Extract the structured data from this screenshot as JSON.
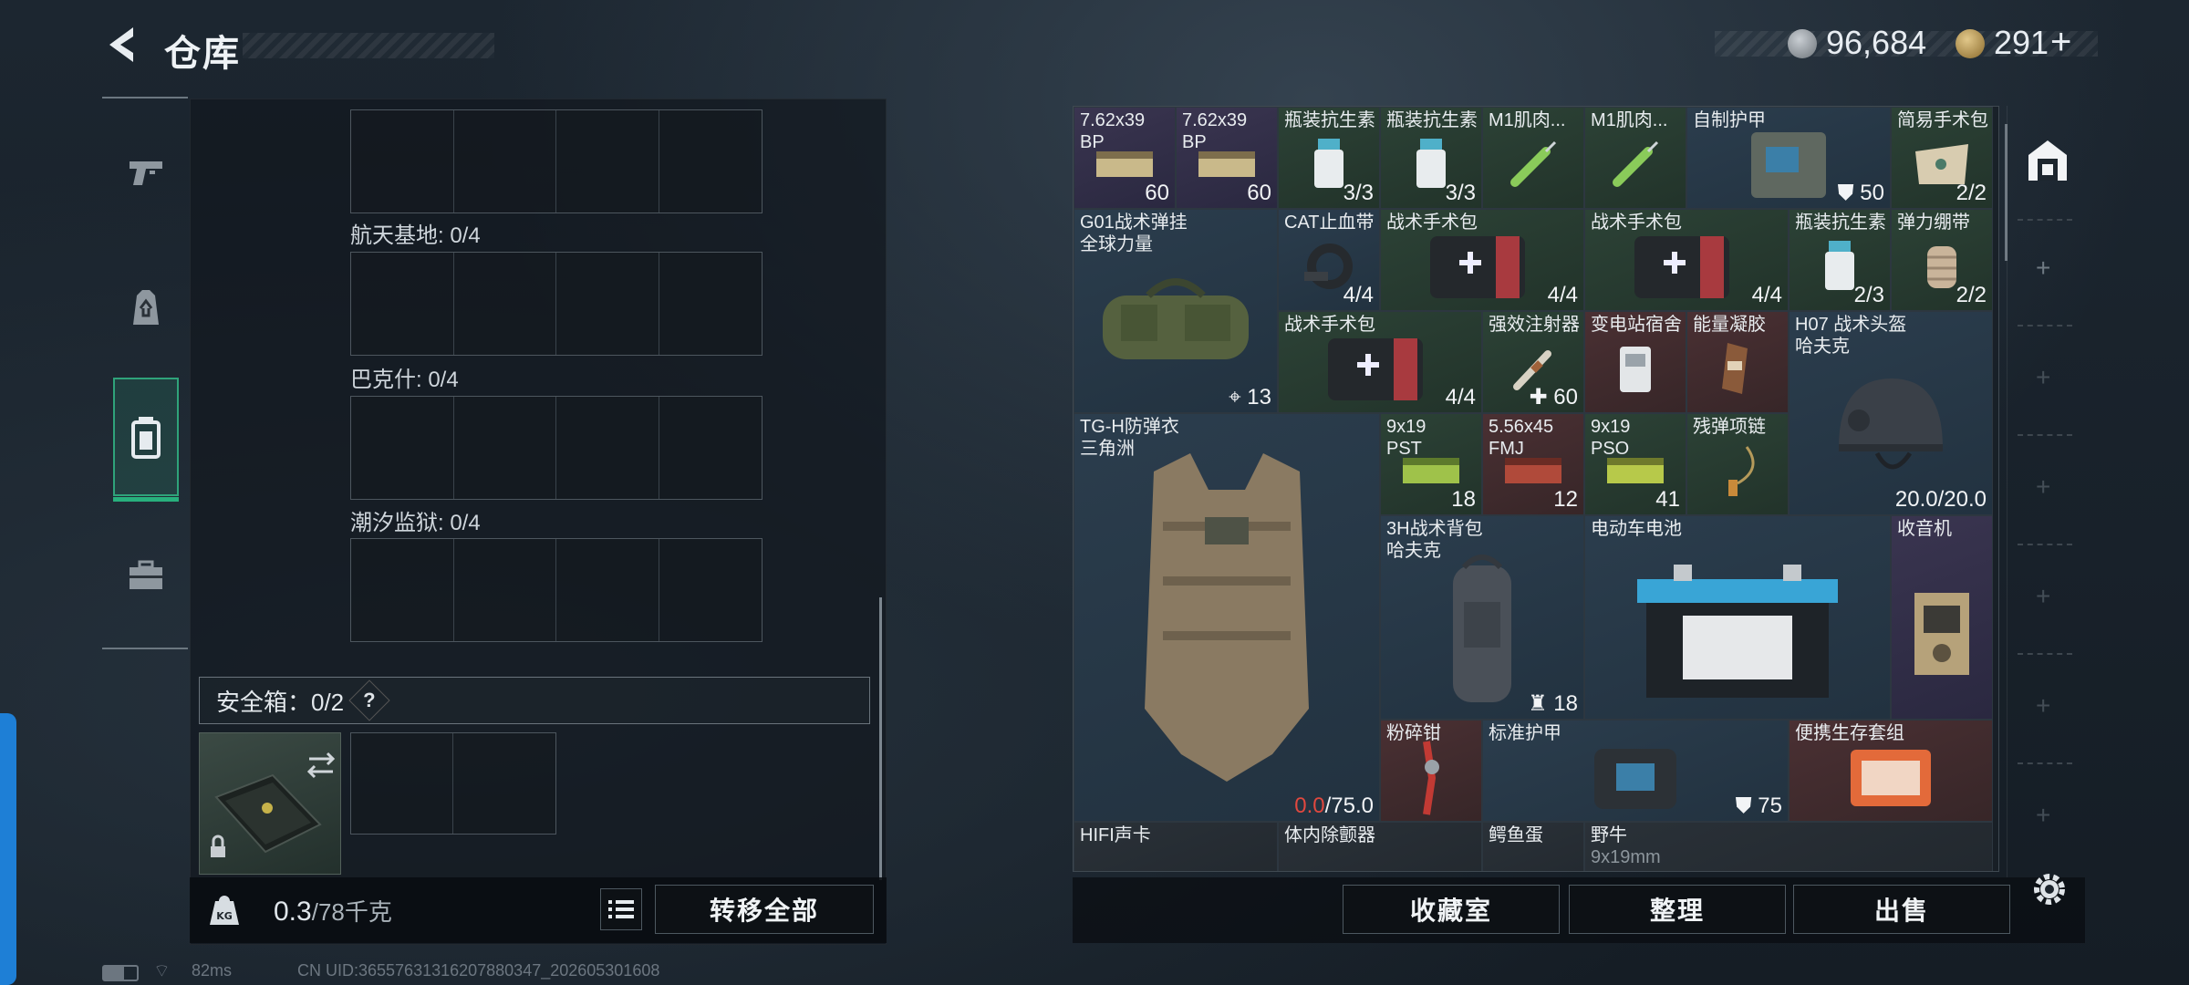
{
  "header": {
    "title": "仓库",
    "currency": [
      {
        "icon": "silver-coin-icon",
        "value": "96,684"
      },
      {
        "icon": "gold-coin-icon",
        "value": "291"
      }
    ],
    "add_symbol": "+"
  },
  "sidebar": {
    "tabs": [
      {
        "icon": "pistol-icon",
        "active": false
      },
      {
        "icon": "backpack-icon",
        "active": false
      },
      {
        "icon": "container-icon",
        "active": true
      },
      {
        "icon": "toolbox-icon",
        "active": false
      }
    ]
  },
  "left_panel": {
    "containers": [
      {
        "label": "航天基地: 0/4"
      },
      {
        "label": "巴克什: 0/4"
      },
      {
        "label": "潮汐监狱: 0/4"
      }
    ],
    "safe_box": {
      "label": "安全箱：0/2",
      "help": "?"
    },
    "weight": {
      "current": "0.3",
      "max": "/78千克"
    },
    "transfer_all": "转移全部"
  },
  "inventory": {
    "items": [
      {
        "name": "7.62x39",
        "sub": "BP",
        "count": "60",
        "bg": "purple"
      },
      {
        "name": "7.62x39",
        "sub": "BP",
        "count": "60",
        "bg": "purple"
      },
      {
        "name": "瓶装抗生素",
        "sub": "",
        "count": "3/3",
        "bg": "green"
      },
      {
        "name": "瓶装抗生素",
        "sub": "",
        "count": "3/3",
        "bg": "green"
      },
      {
        "name": "M1肌肉...",
        "sub": "",
        "count": "",
        "bg": "green"
      },
      {
        "name": "M1肌肉...",
        "sub": "",
        "count": "",
        "bg": "green"
      },
      {
        "name": "自制护甲",
        "sub": "",
        "count": "50",
        "bg": "blue"
      },
      {
        "name": "简易手术包",
        "sub": "",
        "count": "2/2",
        "bg": "green"
      },
      {
        "name": "G01战术弹挂",
        "sub": "全球力量",
        "count": "13",
        "bg": "blue"
      },
      {
        "name": "CAT止血带",
        "sub": "",
        "count": "4/4",
        "bg": "blue"
      },
      {
        "name": "战术手术包",
        "sub": "",
        "count": "4/4",
        "bg": "green"
      },
      {
        "name": "战术手术包",
        "sub": "",
        "count": "4/4",
        "bg": "green"
      },
      {
        "name": "瓶装抗生素",
        "sub": "",
        "count": "2/3",
        "bg": "green"
      },
      {
        "name": "弹力绷带",
        "sub": "",
        "count": "2/2",
        "bg": "green"
      },
      {
        "name": "战术手术包",
        "sub": "",
        "count": "4/4",
        "bg": "green"
      },
      {
        "name": "强效注射器",
        "sub": "",
        "count": "60",
        "bg": "green"
      },
      {
        "name": "变电站宿舍",
        "sub": "",
        "count": "",
        "bg": "red"
      },
      {
        "name": "能量凝胶",
        "sub": "",
        "count": "",
        "bg": "red"
      },
      {
        "name": "H07 战术头盔",
        "sub": "哈夫克",
        "count": "20.0/20.0",
        "bg": "blue"
      },
      {
        "name": "TG-H防弹衣",
        "sub": "三角洲",
        "count_red": "0.0",
        "count": "/75.0",
        "bg": "blue"
      },
      {
        "name": "9x19",
        "sub": "PST",
        "count": "18",
        "bg": "green"
      },
      {
        "name": "5.56x45",
        "sub": "FMJ",
        "count": "12",
        "bg": "red"
      },
      {
        "name": "9x19",
        "sub": "PSO",
        "count": "41",
        "bg": "green"
      },
      {
        "name": "残弹项链",
        "sub": "",
        "count": "",
        "bg": "green"
      },
      {
        "name": "3H战术背包",
        "sub": "哈夫克",
        "count": "18",
        "bg": "blue"
      },
      {
        "name": "电动车电池",
        "sub": "",
        "count": "",
        "bg": "blue"
      },
      {
        "name": "收音机",
        "sub": "",
        "count": "",
        "bg": "purple"
      },
      {
        "name": "粉碎钳",
        "sub": "",
        "count": "",
        "bg": "red"
      },
      {
        "name": "标准护甲",
        "sub": "",
        "count": "75",
        "bg": "blue"
      },
      {
        "name": "便携生存套组",
        "sub": "",
        "count": "",
        "bg": "red"
      },
      {
        "name": "HIFI声卡",
        "sub": "",
        "count": "",
        "bg": "dark"
      },
      {
        "name": "体内除颤器",
        "sub": "",
        "count": "",
        "bg": "dark"
      },
      {
        "name": "鳄鱼蛋",
        "sub": "",
        "count": "",
        "bg": "dark"
      },
      {
        "name": "野牛",
        "sub": "9x19mm",
        "count": "",
        "bg": "dark"
      }
    ],
    "buttons": {
      "collection": "收藏室",
      "sort": "整理",
      "sell": "出售"
    }
  },
  "status": {
    "ping": "82ms",
    "uid": "CN UID:3655763131620788034​7_202605301608"
  },
  "colors": {
    "accent_green": "#2fa37a",
    "broken_red": "#e0483f",
    "edge_blue": "#1e7fd6"
  }
}
